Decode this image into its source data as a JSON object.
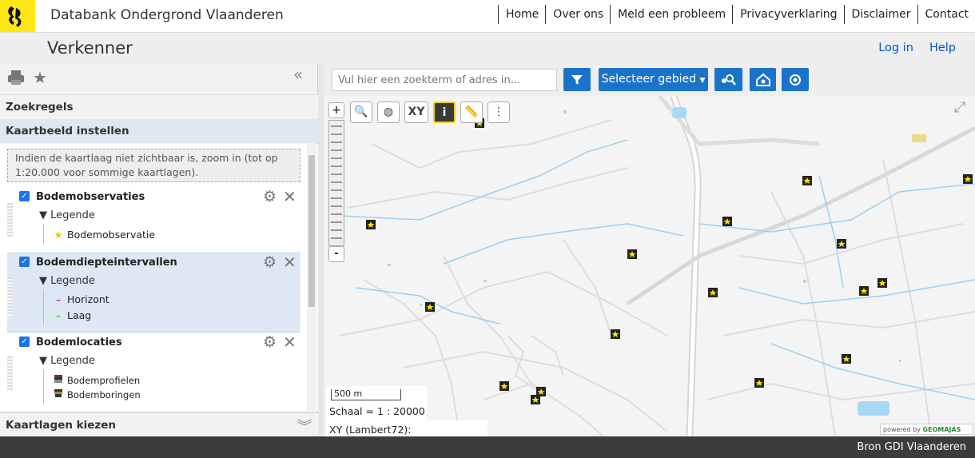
{
  "header": {
    "app_title": "Databank Ondergrond Vlaanderen",
    "nav": [
      "Home",
      "Over ons",
      "Meld een probleem",
      "Privacyverklaring",
      "Disclaimer",
      "Contact"
    ]
  },
  "subheader": {
    "page_title": "Verkenner",
    "login": "Log in",
    "help": "Help"
  },
  "left_panel": {
    "section_zoekregels": "Zoekregels",
    "section_kaartbeeld": "Kaartbeeld instellen",
    "notice": "Indien de kaartlaag niet zichtbaar is, zoom in (tot op 1:20.000 voor sommige kaartlagen).",
    "section_kaartlagen": "Kaartlagen kiezen",
    "layers": [
      {
        "name": "Bodemobservaties",
        "legend_label": "Legende",
        "items": [
          "Bodemobservatie"
        ]
      },
      {
        "name": "Bodemdiepteintervallen",
        "legend_label": "Legende",
        "items": [
          "Horizont",
          "Laag"
        ]
      },
      {
        "name": "Bodemlocaties",
        "legend_label": "Legende",
        "items": [
          "Bodemprofielen",
          "Bodemboringen"
        ]
      }
    ]
  },
  "map": {
    "search_placeholder": "Vul hier een zoekterm of adres in...",
    "select_area": "Selecteer gebied",
    "xy_button": "XY",
    "scalebar_label": "500 m",
    "scale_text": "Schaal = 1 : 20000",
    "xy_readout": "XY (Lambert72):",
    "powered_by": "powered by",
    "powered_brand": "GEOMAJAS"
  },
  "footer": {
    "source": "Bron GDI Vlaanderen"
  },
  "colors": {
    "accent_blue": "#1a73c8",
    "header_yellow": "#ffe615",
    "marker_yellow": "#f5e10b",
    "footer_dark": "#3c3c3c",
    "horizont": "#e020c0",
    "laag": "#40e020"
  }
}
